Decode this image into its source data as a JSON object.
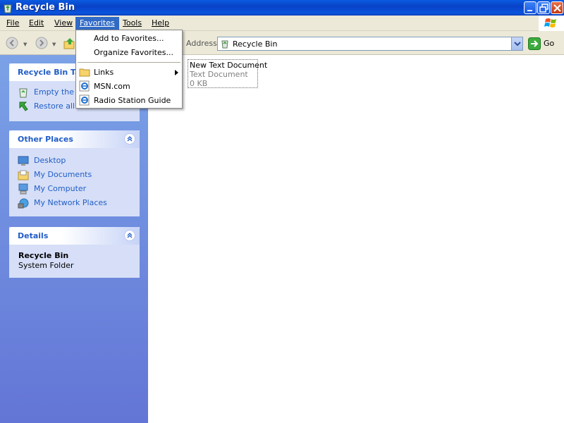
{
  "window": {
    "title": "Recycle Bin",
    "icon": "recycle-bin-icon",
    "controls": [
      "minimize-icon",
      "maximize-icon",
      "close-icon"
    ]
  },
  "menubar": {
    "items": [
      {
        "label": "File"
      },
      {
        "label": "Edit"
      },
      {
        "label": "View"
      },
      {
        "label": "Favorites",
        "active": true
      },
      {
        "label": "Tools"
      },
      {
        "label": "Help"
      }
    ]
  },
  "toolbar": {
    "back_icon": "back-arrow-icon",
    "forward_icon": "forward-arrow-icon",
    "up_icon": "up-folder-icon",
    "address_label": "Address",
    "address_value": "Recycle Bin",
    "go_label": "Go"
  },
  "favorites_menu": {
    "items": [
      {
        "label": "Add to Favorites...",
        "icon": null
      },
      {
        "label": "Organize Favorites...",
        "icon": null
      },
      {
        "label": "Links",
        "icon": "folder-icon",
        "submenu": true
      },
      {
        "label": "MSN.com",
        "icon": "ie-link-icon"
      },
      {
        "label": "Radio Station Guide",
        "icon": "ie-link-icon"
      }
    ]
  },
  "task_pane": {
    "recycle_tasks": {
      "title": "Recycle Bin Tasks",
      "links": [
        {
          "label": "Empty the Recycle Bin",
          "icon": "empty-recycle-bin-icon"
        },
        {
          "label": "Restore all items",
          "icon": "restore-arrow-icon"
        }
      ]
    },
    "other_places": {
      "title": "Other Places",
      "links": [
        {
          "label": "Desktop",
          "icon": "desktop-icon"
        },
        {
          "label": "My Documents",
          "icon": "my-documents-icon"
        },
        {
          "label": "My Computer",
          "icon": "my-computer-icon"
        },
        {
          "label": "My Network Places",
          "icon": "network-places-icon"
        }
      ]
    },
    "details": {
      "title": "Details",
      "name": "Recycle Bin",
      "type": "System Folder"
    }
  },
  "files": [
    {
      "name": "New Text Document",
      "type": "Text Document",
      "size": "0 KB"
    }
  ],
  "colors": {
    "title_bar": "#0a54dc",
    "menu_highlight": "#316ac5",
    "task_pane": "#6e8ddf",
    "link_text": "#215dc6",
    "menu_bar": "#ece9d8"
  }
}
